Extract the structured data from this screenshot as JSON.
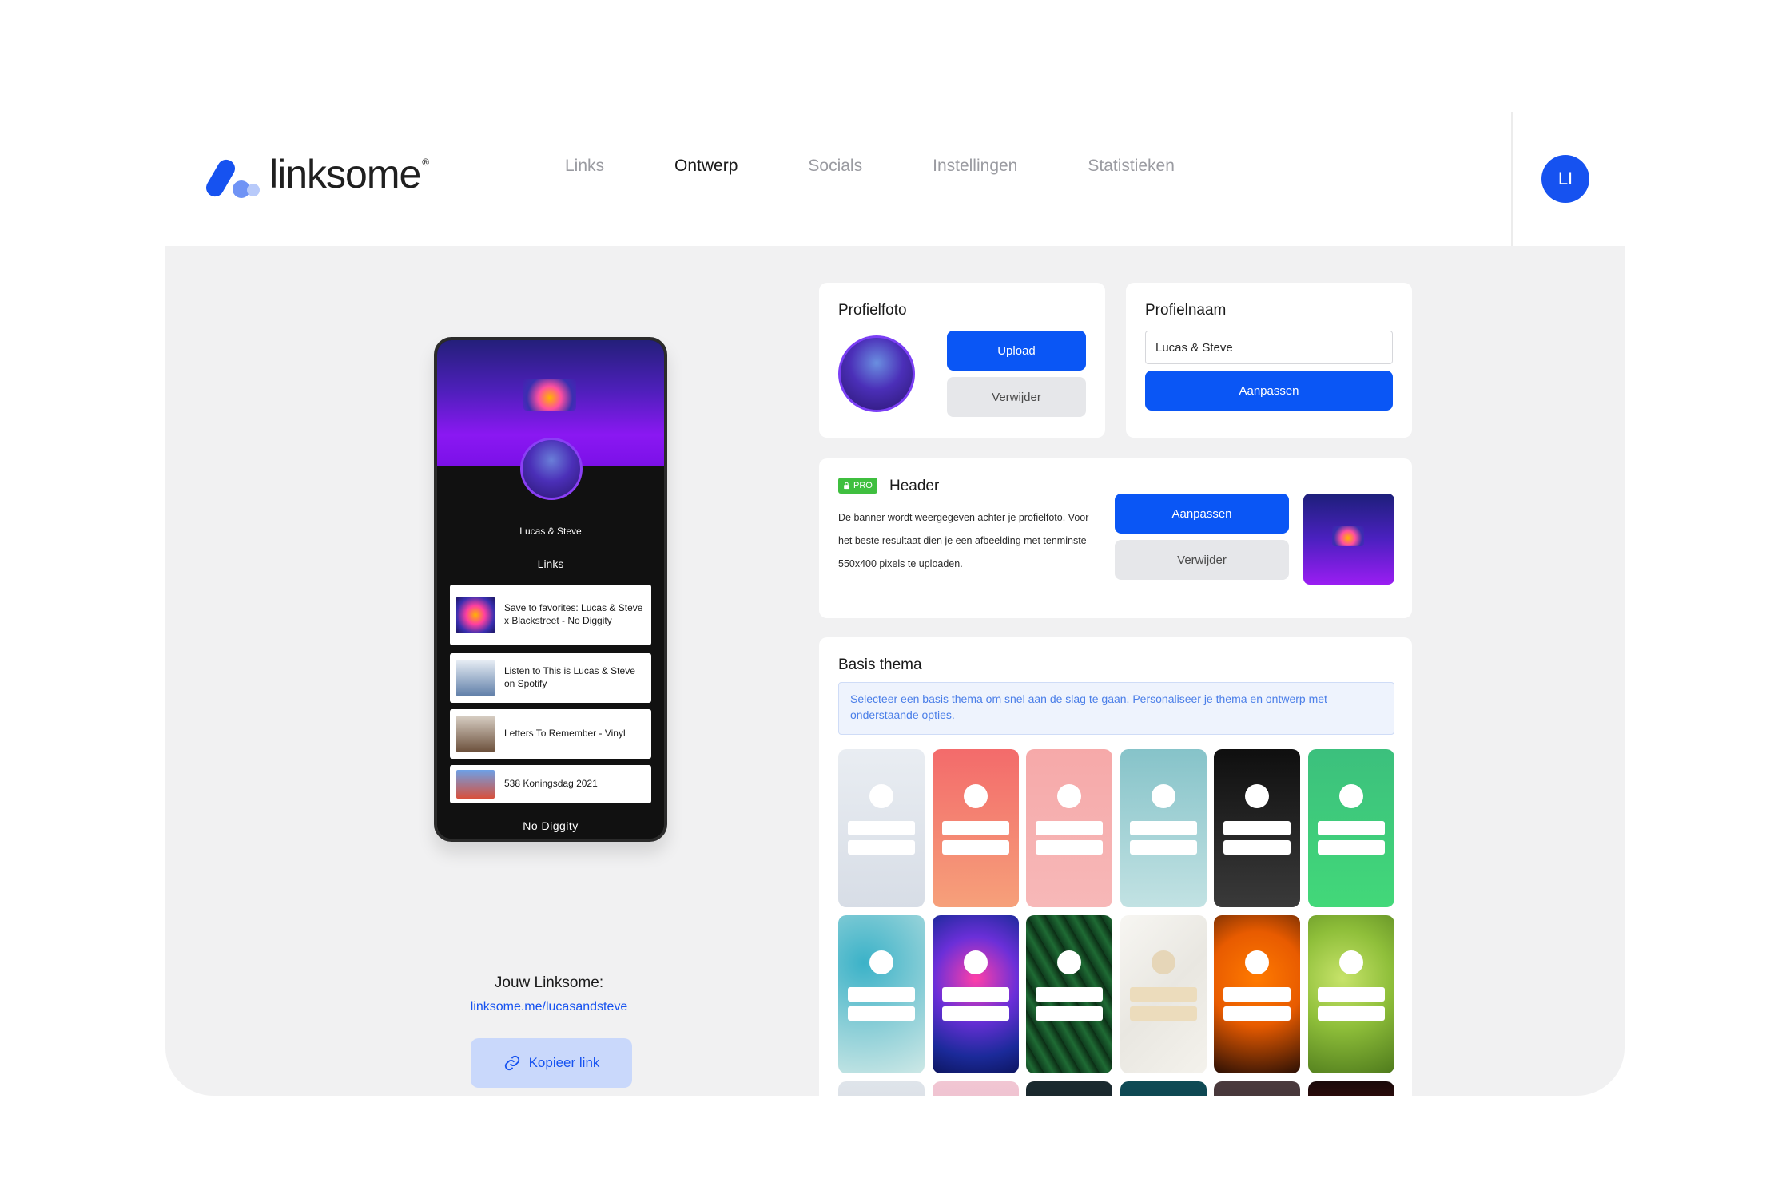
{
  "brand": {
    "name": "linksome",
    "reg": "®"
  },
  "nav": [
    {
      "label": "Links",
      "active": false
    },
    {
      "label": "Ontwerp",
      "active": true
    },
    {
      "label": "Socials",
      "active": false
    },
    {
      "label": "Instellingen",
      "active": false
    },
    {
      "label": "Statistieken",
      "active": false
    }
  ],
  "user": {
    "initials": "LI"
  },
  "preview": {
    "name": "Lucas & Steve",
    "links_label": "Links",
    "links": [
      {
        "text": "Save to favorites: Lucas & Steve x Blackstreet - No Diggity"
      },
      {
        "text": "Listen to This is Lucas & Steve on Spotify"
      },
      {
        "text": "Letters To Remember - Vinyl"
      },
      {
        "text": "538 Koningsdag 2021"
      }
    ],
    "footer": "No Diggity"
  },
  "share": {
    "label": "Jouw Linksome:",
    "url": "linksome.me/lucasandsteve",
    "copy_label": "Kopieer link"
  },
  "profile_photo": {
    "title": "Profielfoto",
    "upload_label": "Upload",
    "remove_label": "Verwijder"
  },
  "profile_name": {
    "title": "Profielnaam",
    "value": "Lucas & Steve",
    "submit_label": "Aanpassen"
  },
  "header_card": {
    "badge": "PRO",
    "title": "Header",
    "description": "De banner wordt weergegeven achter je profielfoto. Voor het beste resultaat dien je een afbeelding met tenminste 550x400 pixels te uploaden.",
    "edit_label": "Aanpassen",
    "remove_label": "Verwijder"
  },
  "themes": {
    "title": "Basis thema",
    "info": "Selecteer een basis thema om snel aan de slag te gaan. Personaliseer je thema en ontwerp met onderstaande opties.",
    "tiles": [
      {
        "name": "light-grey",
        "bg": "linear-gradient(180deg,#e9edf2,#d7dde6)"
      },
      {
        "name": "coral",
        "bg": "linear-gradient(180deg,#f36b6b,#f6a07a)"
      },
      {
        "name": "pink",
        "bg": "linear-gradient(180deg,#f6a9a9,#f7b8b8)"
      },
      {
        "name": "teal",
        "bg": "linear-gradient(180deg,#86c3c9,#c2e2e3)"
      },
      {
        "name": "black",
        "bg": "linear-gradient(180deg,#0f0f0f,#3a3a3a)"
      },
      {
        "name": "green",
        "bg": "linear-gradient(180deg,#3cc07d,#42d879)"
      },
      {
        "name": "aqua-paint",
        "bg": "radial-gradient(circle at 30% 30%,#3bb2c8,#8fd0d8 55%,#cde8e6)"
      },
      {
        "name": "color-powder",
        "bg": "radial-gradient(circle at 50% 40%,#ff3fa8,#6b2fd8 40%,#1b2a9a 75%,#0d1560)"
      },
      {
        "name": "jungle",
        "bg": "repeating-linear-gradient(60deg,#0f3d1e 0px,#1f6b34 10px,#0b2b14 20px)"
      },
      {
        "name": "marble",
        "bg": "linear-gradient(135deg,#f7f6f2,#e9e7e1 50%,#f4f2ec)"
      },
      {
        "name": "orange-smoke",
        "bg": "radial-gradient(circle at 50% 40%,#ff7a00,#e85b00 45%,#2a0f05)"
      },
      {
        "name": "bokeh-green",
        "bg": "radial-gradient(circle at 40% 40%,#c7e36a,#8fbf3a 45%,#4e7a1c)"
      },
      {
        "name": "frost",
        "bg": "linear-gradient(180deg,#dfe4ea,#c8cfd8)"
      },
      {
        "name": "blush",
        "bg": "linear-gradient(180deg,#f1c6d3,#e8a9bd)"
      },
      {
        "name": "dark-leaves",
        "bg": "linear-gradient(180deg,#1b2a2f,#0c1417)"
      },
      {
        "name": "deep-teal",
        "bg": "linear-gradient(180deg,#0f4a55,#0a2f36)"
      },
      {
        "name": "dusk",
        "bg": "linear-gradient(180deg,#4a3a3d,#2a2022)"
      },
      {
        "name": "red-neon",
        "bg": "linear-gradient(180deg,#1a0a0a,#c01818)"
      }
    ]
  },
  "colors": {
    "accent": "#0a56f5",
    "pro_green": "#3fbf3f"
  }
}
